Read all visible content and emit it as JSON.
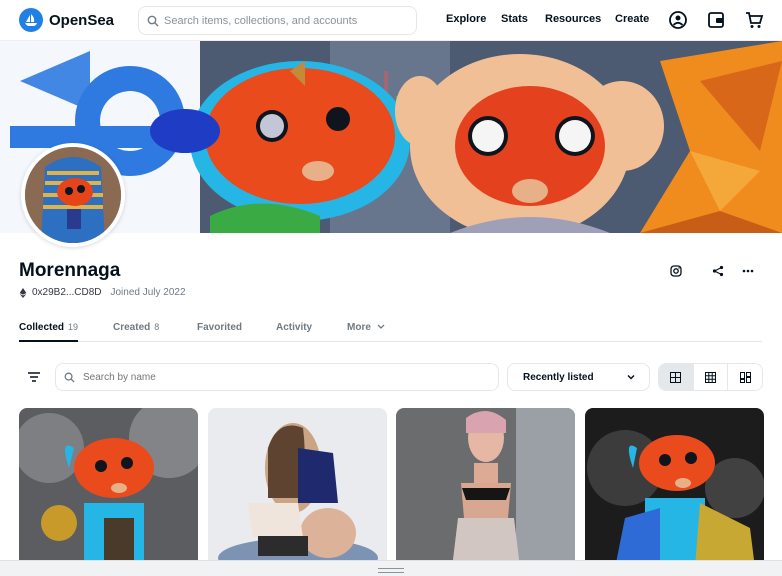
{
  "header": {
    "logo_text": "OpenSea",
    "search_placeholder": "Search items, collections, and accounts",
    "nav": [
      "Explore",
      "Stats",
      "Resources",
      "Create"
    ],
    "icons": [
      "account-icon",
      "wallet-icon",
      "cart-icon"
    ]
  },
  "profile": {
    "name": "Morennaga",
    "address": "0x29B2...CD8D",
    "joined": "Joined July 2022"
  },
  "tabs": [
    {
      "label": "Collected",
      "count": "19",
      "active": true
    },
    {
      "label": "Created",
      "count": "8",
      "active": false
    },
    {
      "label": "Favorited",
      "count": "",
      "active": false
    },
    {
      "label": "Activity",
      "count": "",
      "active": false
    },
    {
      "label": "More",
      "count": "",
      "active": false
    }
  ],
  "toolbar": {
    "search_placeholder": "Search by name",
    "sort_label": "Recently listed"
  },
  "colors": {
    "accent": "#2081e2",
    "text": "#04111d",
    "muted": "#707a83",
    "border": "#e5e8eb"
  }
}
